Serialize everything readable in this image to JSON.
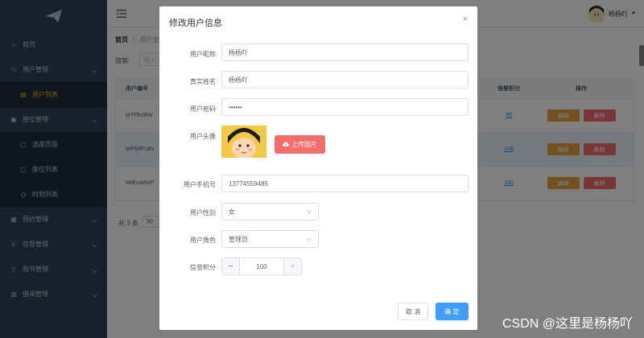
{
  "sidebar": {
    "items": [
      {
        "label": "首页",
        "icon": "home-icon",
        "type": "top",
        "arrow": false
      },
      {
        "label": "用户管理",
        "icon": "user-icon",
        "type": "top",
        "arrow": true
      },
      {
        "label": "用户列表",
        "icon": "list-icon",
        "type": "sub",
        "active": true
      },
      {
        "label": "座位管理",
        "icon": "seat-icon",
        "type": "top",
        "arrow": true
      },
      {
        "label": "选座页面",
        "icon": "page-icon",
        "type": "sub"
      },
      {
        "label": "座位列表",
        "icon": "page-icon",
        "type": "sub"
      },
      {
        "label": "时刻列表",
        "icon": "clock-icon",
        "type": "sub"
      },
      {
        "label": "预约管理",
        "icon": "calendar-icon",
        "type": "top",
        "arrow": true
      },
      {
        "label": "信誉管理",
        "icon": "trophy-icon",
        "type": "top",
        "arrow": true
      },
      {
        "label": "图书管理",
        "icon": "book-icon",
        "type": "top",
        "arrow": true
      },
      {
        "label": "借阅管理",
        "icon": "borrow-icon",
        "type": "top",
        "arrow": true
      }
    ]
  },
  "navbar": {
    "username": "杨杨吖"
  },
  "breadcrumb": {
    "home": "首页",
    "sep": "/",
    "current": "用户管"
  },
  "search": {
    "label": "搜索:",
    "placeholder": "输入"
  },
  "table": {
    "headers": {
      "id": "用户编号",
      "credit": "信誉积分",
      "actions": "操作"
    },
    "rows": [
      {
        "id": "pIYFbcBW",
        "credit": "95",
        "highlight": false
      },
      {
        "id": "WPb9PoBx",
        "credit": "100",
        "highlight": true
      },
      {
        "id": "WtExaWxP",
        "credit": "100",
        "highlight": false
      }
    ],
    "edit_label": "编辑",
    "delete_label": "删除"
  },
  "pagination": {
    "total": "共 3 条",
    "size": "50"
  },
  "modal": {
    "title": "修改用户信息",
    "close_icon": "×",
    "fields": {
      "nickname": {
        "label": "用户昵称",
        "value": "杨杨吖"
      },
      "realname": {
        "label": "真实姓名",
        "value": "杨杨吖"
      },
      "password": {
        "label": "用户密码",
        "value": "••••••"
      },
      "avatar": {
        "label": "用户头像"
      },
      "phone": {
        "label": "用户手机号",
        "value": "13774559485"
      },
      "gender": {
        "label": "用户性别",
        "value": "女"
      },
      "role": {
        "label": "用户角色",
        "value": "管理员"
      },
      "credit": {
        "label": "信誉积分",
        "value": "100"
      }
    },
    "upload_label": "上传图片",
    "cancel_label": "取 消",
    "ok_label": "确 定"
  },
  "watermark": "CSDN @这里是杨杨吖",
  "colors": {
    "sidebar_bg": "#304156",
    "active_menu": "#f4b400",
    "primary": "#409eff",
    "danger": "#f56c6c",
    "warning": "#e6a23c"
  }
}
